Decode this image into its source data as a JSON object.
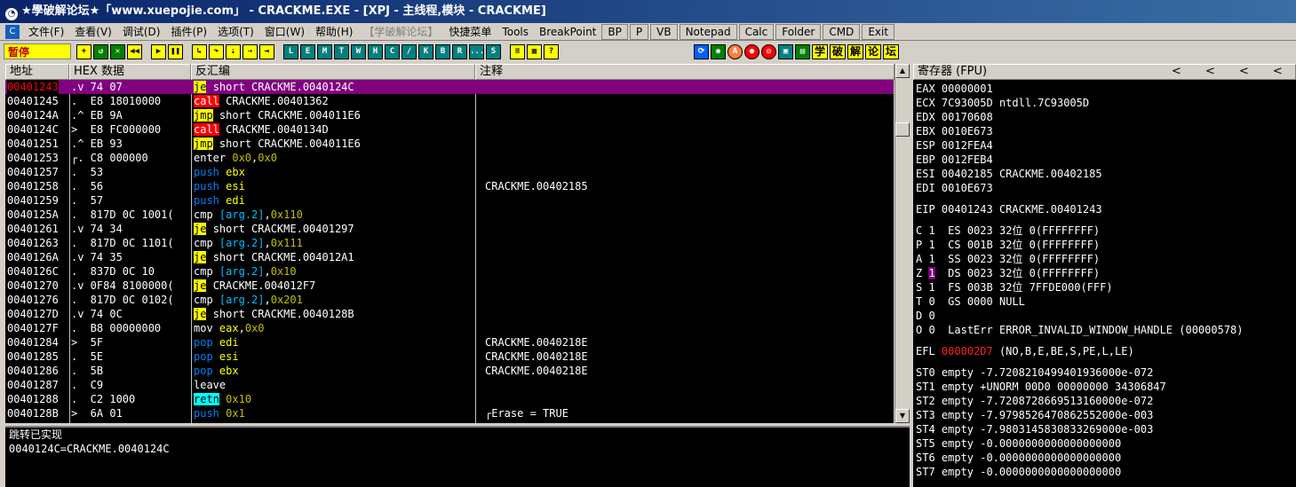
{
  "window": {
    "title": "★學破解论坛★「www.xuepojie.com」 - CRACKME.EXE - [XPJ - 主线程,模块 - CRACKME]"
  },
  "menu": {
    "items": [
      "文件(F)",
      "查看(V)",
      "调试(D)",
      "插件(P)",
      "选项(T)",
      "窗口(W)",
      "帮助(H)",
      "【学破解论坛】",
      "快捷菜单",
      "Tools",
      "BreakPoint"
    ],
    "buttons": [
      "BP",
      "P",
      "VB",
      "Notepad",
      "Calc",
      "Folder",
      "CMD",
      "Exit"
    ]
  },
  "toolbar": {
    "status": "暂停",
    "letters": [
      "L",
      "E",
      "M",
      "T",
      "W",
      "H",
      "C",
      "/",
      "K",
      "B",
      "R",
      "...",
      "S"
    ],
    "cjk": [
      "学",
      "破",
      "解",
      "论",
      "坛"
    ]
  },
  "cpu": {
    "headers": {
      "addr": "地址",
      "hex": "HEX 数据",
      "dis": "反汇编",
      "cmt": "注释"
    },
    "rows": [
      {
        "addr": "00401243",
        "mk": ".v",
        "hex": "74 07",
        "mn": "je",
        "op": "short CRACKME.0040124C",
        "cmt": ""
      },
      {
        "addr": "00401245",
        "mk": ".",
        "hex": "E8 18010000",
        "mn": "call",
        "op": "CRACKME.00401362",
        "cmt": ""
      },
      {
        "addr": "0040124A",
        "mk": ".^",
        "hex": "EB 9A",
        "mn": "jmp",
        "op": "short CRACKME.004011E6",
        "cmt": ""
      },
      {
        "addr": "0040124C",
        "mk": ">",
        "hex": "E8 FC000000",
        "mn": "call",
        "op": "CRACKME.0040134D",
        "cmt": ""
      },
      {
        "addr": "00401251",
        "mk": ".^",
        "hex": "EB 93",
        "mn": "jmp",
        "op": "short CRACKME.004011E6",
        "cmt": ""
      },
      {
        "addr": "00401253",
        "mk": "┌.",
        "hex": "C8 000000",
        "mn": "enter",
        "op": "0x0,0x0",
        "cmt": ""
      },
      {
        "addr": "00401257",
        "mk": ".",
        "hex": "53",
        "mn": "push",
        "op": "ebx",
        "cmt": ""
      },
      {
        "addr": "00401258",
        "mk": ".",
        "hex": "56",
        "mn": "push",
        "op": "esi",
        "cmt": "CRACKME.00402185"
      },
      {
        "addr": "00401259",
        "mk": ".",
        "hex": "57",
        "mn": "push",
        "op": "edi",
        "cmt": ""
      },
      {
        "addr": "0040125A",
        "mk": ".",
        "hex": "817D 0C 1001(",
        "mn": "cmp",
        "op": "[arg.2],0x110",
        "cmt": ""
      },
      {
        "addr": "00401261",
        "mk": ".v",
        "hex": "74 34",
        "mn": "je",
        "op": "short CRACKME.00401297",
        "cmt": ""
      },
      {
        "addr": "00401263",
        "mk": ".",
        "hex": "817D 0C 1101(",
        "mn": "cmp",
        "op": "[arg.2],0x111",
        "cmt": ""
      },
      {
        "addr": "0040126A",
        "mk": ".v",
        "hex": "74 35",
        "mn": "je",
        "op": "short CRACKME.004012A1",
        "cmt": ""
      },
      {
        "addr": "0040126C",
        "mk": ".",
        "hex": "837D 0C 10",
        "mn": "cmp",
        "op": "[arg.2],0x10",
        "cmt": ""
      },
      {
        "addr": "00401270",
        "mk": ".v",
        "hex": "0F84 8100000(",
        "mn": "je",
        "op": "CRACKME.004012F7",
        "cmt": ""
      },
      {
        "addr": "00401276",
        "mk": ".",
        "hex": "817D 0C 0102(",
        "mn": "cmp",
        "op": "[arg.2],0x201",
        "cmt": ""
      },
      {
        "addr": "0040127D",
        "mk": ".v",
        "hex": "74 0C",
        "mn": "je",
        "op": "short CRACKME.0040128B",
        "cmt": ""
      },
      {
        "addr": "0040127F",
        "mk": ".",
        "hex": "B8 00000000",
        "mn": "mov",
        "op": "eax,0x0",
        "cmt": ""
      },
      {
        "addr": "00401284",
        "mk": ">",
        "hex": "5F",
        "mn": "pop",
        "op": "edi",
        "cmt": "CRACKME.0040218E"
      },
      {
        "addr": "00401285",
        "mk": ".",
        "hex": "5E",
        "mn": "pop",
        "op": "esi",
        "cmt": "CRACKME.0040218E"
      },
      {
        "addr": "00401286",
        "mk": ".",
        "hex": "5B",
        "mn": "pop",
        "op": "ebx",
        "cmt": "CRACKME.0040218E"
      },
      {
        "addr": "00401287",
        "mk": ".",
        "hex": "C9",
        "mn": "leave",
        "op": "",
        "cmt": ""
      },
      {
        "addr": "00401288",
        "mk": ".",
        "hex": "C2 1000",
        "mn": "retn",
        "op": "0x10",
        "cmt": ""
      },
      {
        "addr": "0040128B",
        "mk": ">",
        "hex": "6A 01",
        "mn": "push",
        "op": "0x1",
        "cmt": "┌Erase = TRUE"
      }
    ]
  },
  "registers": {
    "header": "寄存器 (FPU)",
    "header_arrows": [
      "<",
      "<",
      "<",
      "<"
    ],
    "gp": [
      {
        "name": "EAX",
        "val": "00000001",
        "note": ""
      },
      {
        "name": "ECX",
        "val": "7C93005D",
        "note": "ntdll.7C93005D"
      },
      {
        "name": "EDX",
        "val": "00170608",
        "note": ""
      },
      {
        "name": "EBX",
        "val": "0010E673",
        "note": ""
      },
      {
        "name": "ESP",
        "val": "0012FEA4",
        "note": ""
      },
      {
        "name": "EBP",
        "val": "0012FEB4",
        "note": ""
      },
      {
        "name": "ESI",
        "val": "00402185",
        "note": "CRACKME.00402185"
      },
      {
        "name": "EDI",
        "val": "0010E673",
        "note": ""
      }
    ],
    "eip": {
      "name": "EIP",
      "val": "00401243",
      "note": "CRACKME.00401243"
    },
    "flags": [
      {
        "f": "C",
        "v": "1",
        "seg": "ES",
        "sel": "0023",
        "bits": "32位",
        "base": "0(FFFFFFFF)"
      },
      {
        "f": "P",
        "v": "1",
        "seg": "CS",
        "sel": "001B",
        "bits": "32位",
        "base": "0(FFFFFFFF)"
      },
      {
        "f": "A",
        "v": "1",
        "seg": "SS",
        "sel": "0023",
        "bits": "32位",
        "base": "0(FFFFFFFF)"
      },
      {
        "f": "Z",
        "v": "1",
        "seg": "DS",
        "sel": "0023",
        "bits": "32位",
        "base": "0(FFFFFFFF)"
      },
      {
        "f": "S",
        "v": "1",
        "seg": "FS",
        "sel": "003B",
        "bits": "32位",
        "base": "7FFDE000(FFF)"
      },
      {
        "f": "T",
        "v": "0",
        "seg": "GS",
        "sel": "0000",
        "bits": "NULL",
        "base": ""
      },
      {
        "f": "D",
        "v": "0",
        "seg": "",
        "sel": "",
        "bits": "",
        "base": ""
      },
      {
        "f": "O",
        "v": "0",
        "seg": "LastErr",
        "sel": "ERROR_INVALID_WINDOW_HANDLE (00000578)",
        "bits": "",
        "base": ""
      }
    ],
    "efl": {
      "name": "EFL",
      "val": "000002D7",
      "note": "(NO,B,E,BE,S,PE,L,LE)"
    },
    "fpu": [
      "ST0 empty -7.7208210499401936000e-072",
      "ST1 empty +UNORM 00D0 00000000 34306847",
      "ST2 empty -7.7208728669513160000e-072",
      "ST3 empty -7.9798526470862552000e-003",
      "ST4 empty -7.9803145830833269000e-003",
      "ST5 empty -0.0000000000000000000",
      "ST6 empty -0.0000000000000000000",
      "ST7 empty -0.0000000000000000000"
    ]
  },
  "info": {
    "line1": "跳转已实现",
    "line2": "0040124C=CRACKME.0040124C"
  },
  "colors": {
    "selection": "#800080",
    "jump": "#ffff00",
    "call": "#ff0000",
    "ret": "#00ffff",
    "stack": "#0080ff",
    "status_bg": "#ffff00"
  }
}
